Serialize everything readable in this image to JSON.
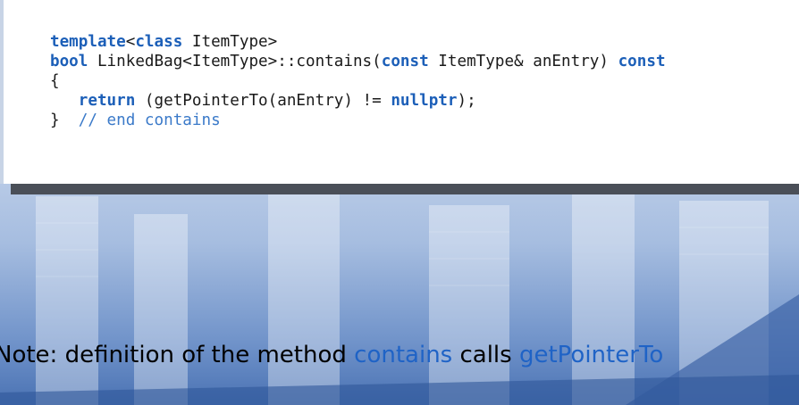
{
  "code": {
    "line1": [
      {
        "text": "template",
        "style": "kw"
      },
      {
        "text": "<",
        "style": "plain"
      },
      {
        "text": "class",
        "style": "kw"
      },
      {
        "text": " ItemType>",
        "style": "plain"
      }
    ],
    "line2": [
      {
        "text": "bool",
        "style": "kw"
      },
      {
        "text": " LinkedBag<ItemType>::contains(",
        "style": "plain"
      },
      {
        "text": "const",
        "style": "kw"
      },
      {
        "text": " ItemType& anEntry) ",
        "style": "plain"
      },
      {
        "text": "const",
        "style": "kw"
      }
    ],
    "line3": "{",
    "line4": [
      {
        "text": "   ",
        "style": "plain"
      },
      {
        "text": "return",
        "style": "kw"
      },
      {
        "text": " (getPointerTo(anEntry) != ",
        "style": "plain"
      },
      {
        "text": "nullptr",
        "style": "kw"
      },
      {
        "text": ");",
        "style": "plain"
      }
    ],
    "line5_brace": "}",
    "line5_comment": "// end contains"
  },
  "note": {
    "prefix": "Note: definition of the method ",
    "method": "contains",
    "middle": " calls ",
    "callee": "getPointerTo"
  },
  "colors": {
    "keyword": "#1c5fb8",
    "comment": "#3b7ac9",
    "highlight": "#1f63c6"
  }
}
